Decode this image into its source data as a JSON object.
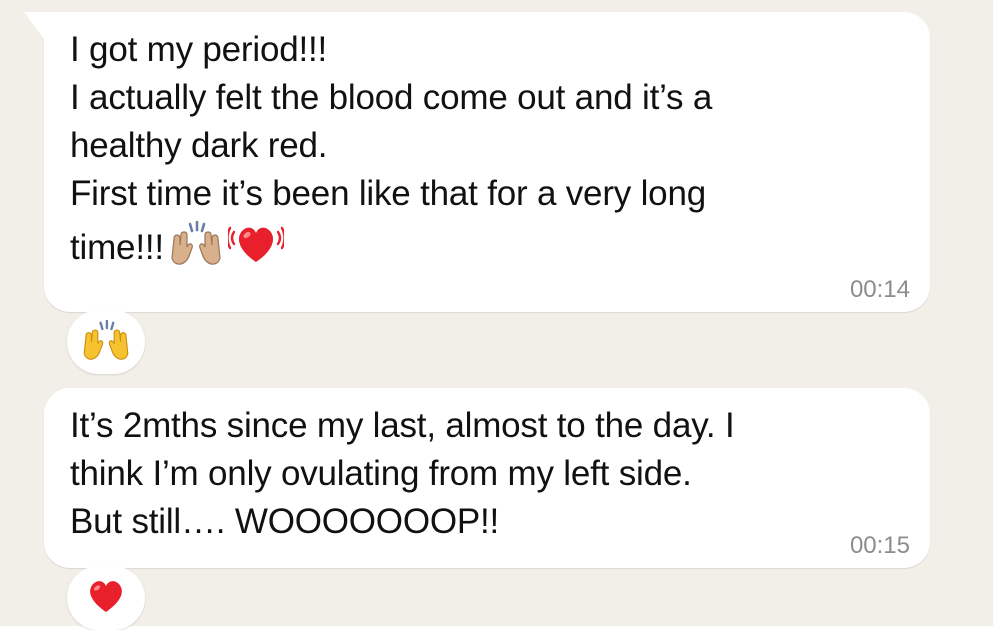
{
  "theme": {
    "background": "#f2efe8",
    "bubble": "#ffffff",
    "text": "#111111",
    "timestamp": "#8c8c8c",
    "heart": "#e8202c",
    "hands_yellow": "#f6c230",
    "hands_tan": "#d9b08c"
  },
  "messages": [
    {
      "lines": [
        "I got my period!!!",
        "I actually felt the blood come out and it’s a",
        "healthy dark red.",
        "First time it’s been like that for a very long",
        "time!!!"
      ],
      "inline_emojis": [
        "raising-hands-medium-skin-icon",
        "beating-heart-icon"
      ],
      "time": "00:14",
      "reaction": "raising-hands-icon"
    },
    {
      "lines": [
        "It’s 2mths since my last, almost to the day. I",
        "think I’m only ovulating from my left side.",
        "But still…. WOOOOOOOP!!"
      ],
      "time": "00:15",
      "reaction": "red-heart-icon"
    }
  ]
}
